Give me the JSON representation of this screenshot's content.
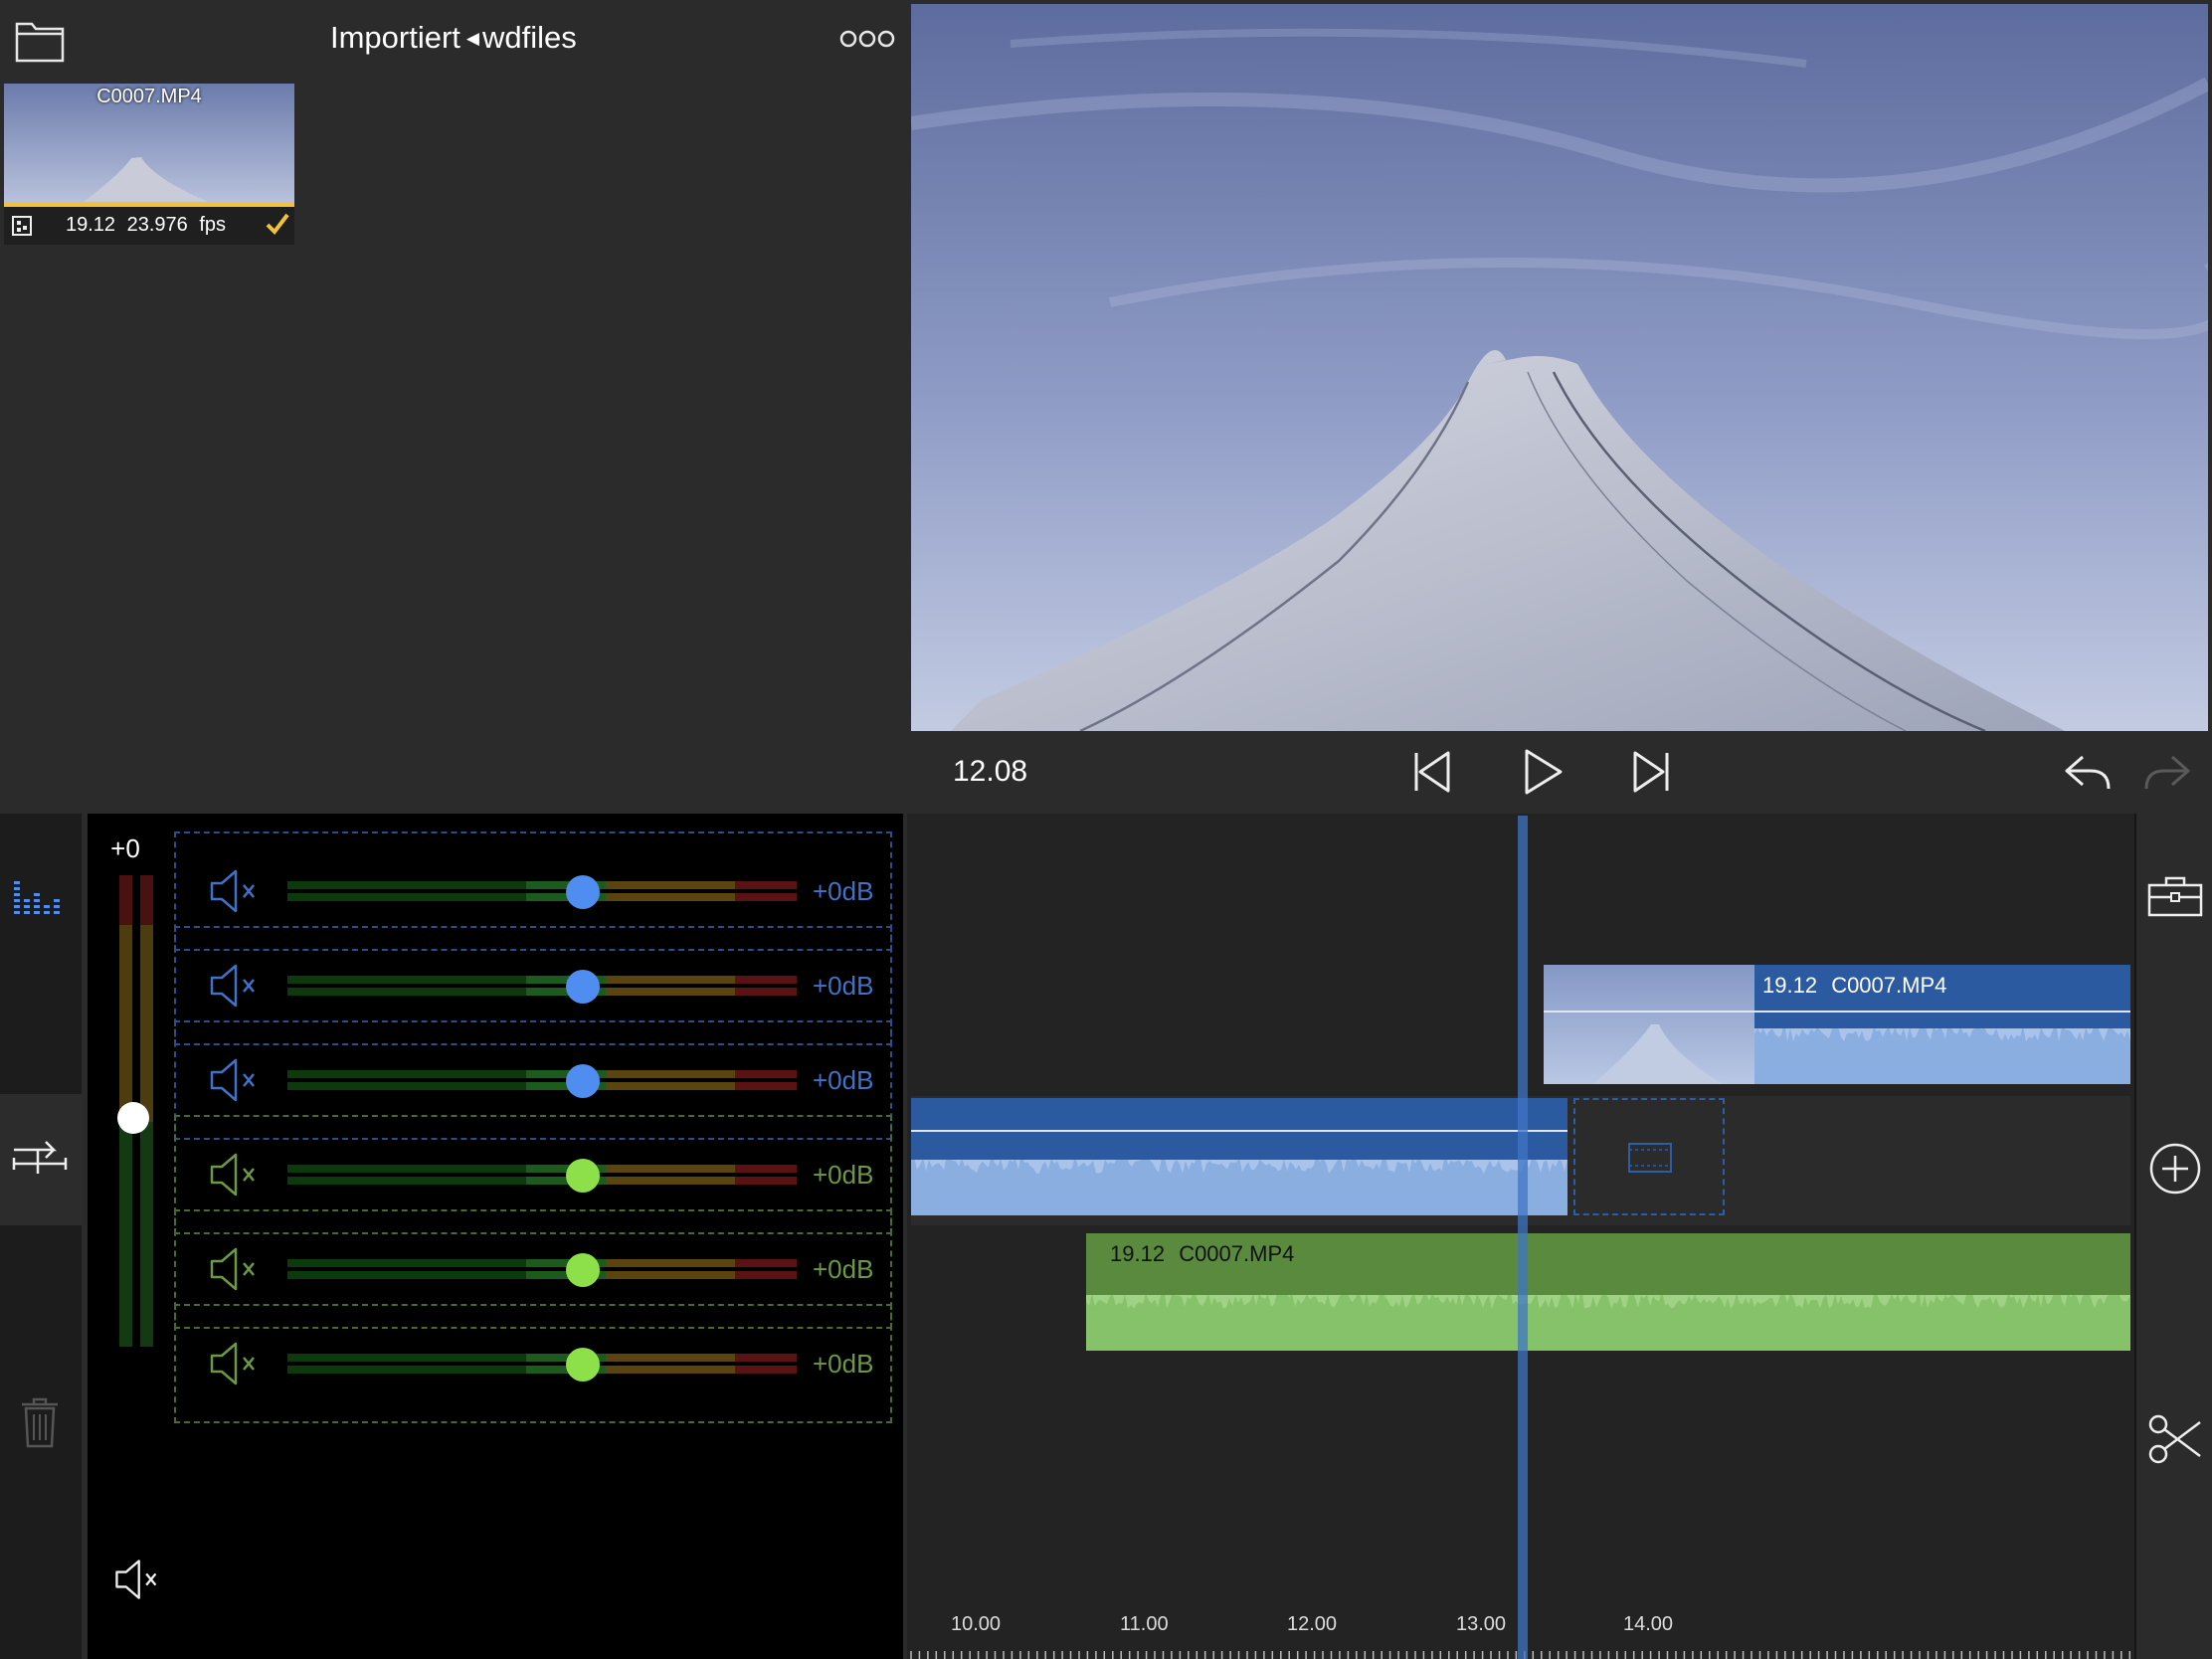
{
  "browser": {
    "title": "Importiert",
    "path": "wdfiles",
    "clip": {
      "name": "C0007.MP4",
      "duration": "19.12",
      "fps": "23.976 fps"
    }
  },
  "viewer": {
    "timecode": "12.08"
  },
  "mixer": {
    "master_label": "+0",
    "channels": [
      {
        "db": "+0dB",
        "kind": "video"
      },
      {
        "db": "+0dB",
        "kind": "video"
      },
      {
        "db": "+0dB",
        "kind": "video"
      },
      {
        "db": "+0dB",
        "kind": "audio"
      },
      {
        "db": "+0dB",
        "kind": "audio"
      },
      {
        "db": "+0dB",
        "kind": "audio"
      }
    ]
  },
  "timeline": {
    "clip_top": {
      "duration": "19.12",
      "name": "C0007.MP4"
    },
    "clip_audio": {
      "duration": "19.12",
      "name": "C0007.MP4"
    },
    "ruler": [
      "10.00",
      "11.00",
      "12.00",
      "13.00",
      "14.00"
    ]
  },
  "colors": {
    "accent": "#f2c23d",
    "video_clip": "#2c5aa0",
    "audio_clip": "#5a8a3e",
    "playhead": "#3f74c4"
  },
  "icons": [
    "folder-icon",
    "more-icon",
    "film-icon",
    "check-icon",
    "skip-back-icon",
    "play-icon",
    "skip-forward-icon",
    "undo-icon",
    "redo-icon",
    "mixer-icon",
    "trim-icon",
    "trash-icon",
    "mute-icon",
    "toolbox-icon",
    "add-icon",
    "scissors-icon"
  ]
}
